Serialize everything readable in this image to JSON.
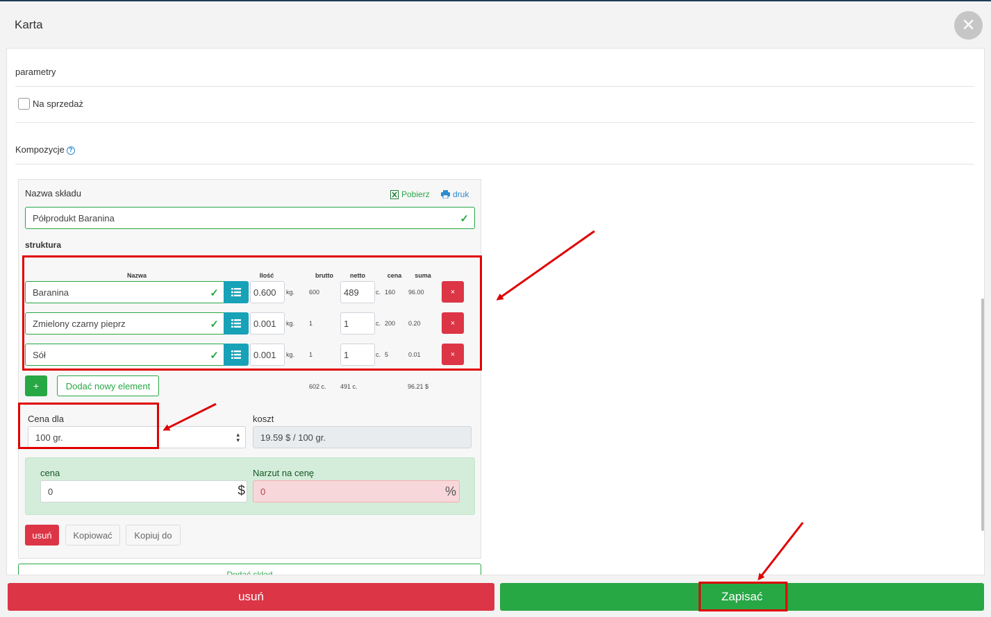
{
  "modal": {
    "title": "Karta",
    "close_glyph": "✕"
  },
  "parametry": {
    "title": "parametry",
    "checkbox_label": "Na sprzedaż",
    "checked": false
  },
  "kompozycje": {
    "title": "Kompozycje",
    "help_glyph": "?",
    "warehouse_label": "Nazwa składu",
    "download_label": "Pobierz",
    "print_label": "druk",
    "warehouse_value": "Półprodukt Baranina",
    "structure_title": "struktura",
    "columns": {
      "name": "Nazwa",
      "qty": "Ilość",
      "gross": "brutto",
      "net": "netto",
      "price": "cena",
      "sum": "suma"
    },
    "rows": [
      {
        "name": "Baranina",
        "qty": "0.600",
        "unit": "kg.",
        "gross": "600",
        "net": "489",
        "net_unit": "c.",
        "price": "160",
        "sum": "96.00",
        "del": "×"
      },
      {
        "name": "Zmielony czarny pieprz",
        "qty": "0.001",
        "unit": "kg.",
        "gross": "1",
        "net": "1",
        "net_unit": "c.",
        "price": "200",
        "sum": "0.20",
        "del": "×"
      },
      {
        "name": "Sół",
        "qty": "0.001",
        "unit": "kg.",
        "gross": "1",
        "net": "1",
        "net_unit": "c.",
        "price": "5",
        "sum": "0.01",
        "del": "×"
      }
    ],
    "add_glyph": "+",
    "add_element_label": "Dodać nowy element",
    "totals": {
      "gross": "602 c.",
      "net": "491 c.",
      "sum": "96.21 $"
    },
    "price_for_label": "Cena dla",
    "price_for_value": "100 gr.",
    "cost_label": "koszt",
    "cost_value": "19.59 $ / 100 gr.",
    "cena_label": "cena",
    "cena_value": "0",
    "cena_suffix": "$",
    "markup_label": "Narzut na cenę",
    "markup_value": "0",
    "markup_suffix": "%",
    "delete_label": "usuń",
    "copy_label": "Kopiować",
    "copy_to_label": "Kopiuj do",
    "add_warehouse_label": "Dodać skład"
  },
  "footer": {
    "delete_label": "usuń",
    "save_label": "Zapisać"
  },
  "colors": {
    "danger": "#dc3545",
    "success": "#28a745",
    "info": "#17a2b8",
    "annotation": "#e00000"
  }
}
